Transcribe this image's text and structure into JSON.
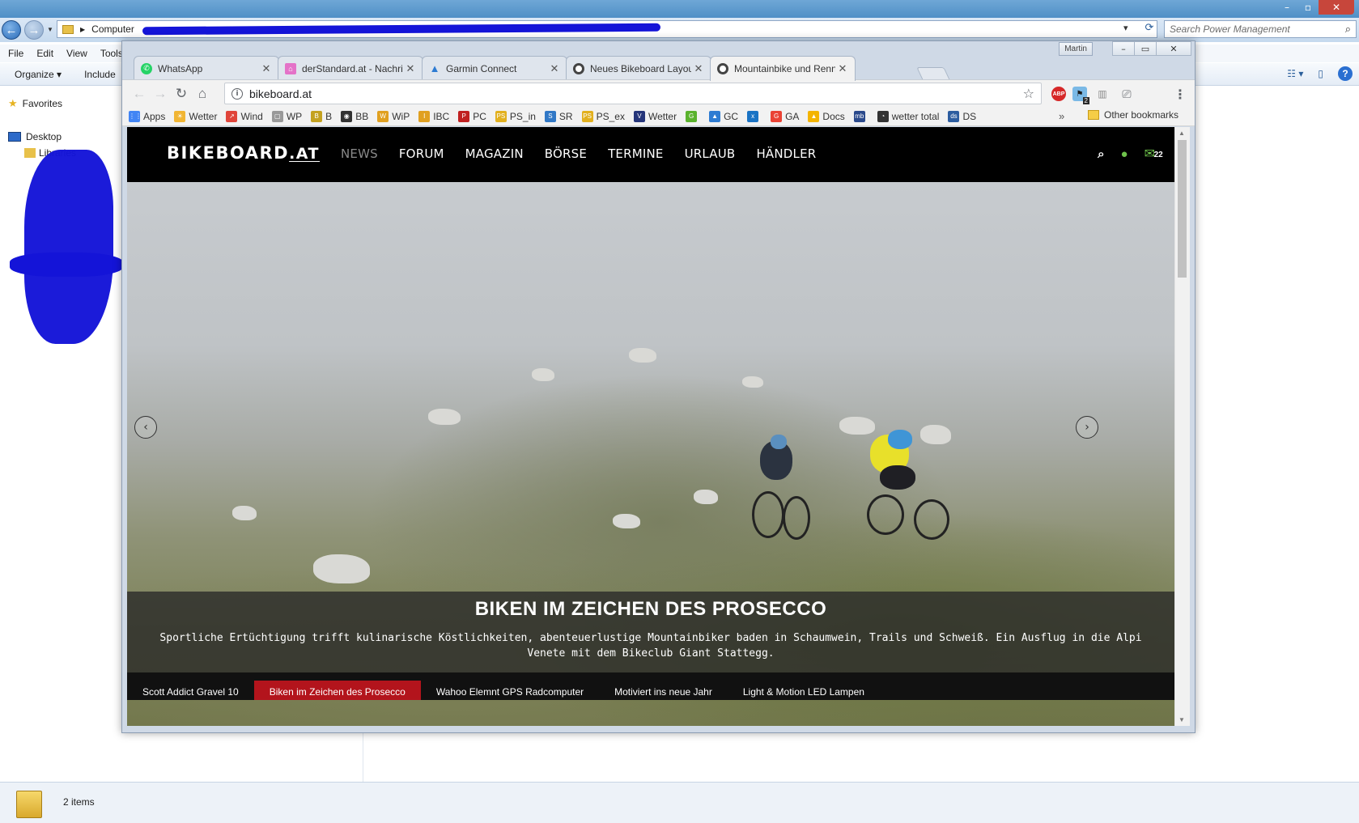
{
  "explorer": {
    "address_root": "Computer",
    "search_placeholder": "Search Power Management",
    "menu": [
      "File",
      "Edit",
      "View",
      "Tools"
    ],
    "toolbar": {
      "organize": "Organize ▾",
      "include": "Include"
    },
    "nav": {
      "favorites": "Favorites",
      "desktop": "Desktop",
      "libraries": "Libraries"
    },
    "status": {
      "items": "2 items"
    },
    "window_controls": {
      "minimize": "–",
      "maximize": "▫",
      "close": "✕"
    }
  },
  "chrome": {
    "profile": "Martin",
    "tabs": [
      {
        "title": "WhatsApp",
        "favicon": "whatsapp-icon",
        "color": "#25d366"
      },
      {
        "title": "derStandard.at - Nachrichten",
        "favicon": "derstandard-icon",
        "color": "#e472c8"
      },
      {
        "title": "Garmin Connect",
        "favicon": "garmin-icon",
        "color": "#2d7bd2"
      },
      {
        "title": "Neues Bikeboard Layout",
        "favicon": "bikeboard-icon",
        "color": "#444444"
      },
      {
        "title": "Mountainbike und Rennrad",
        "favicon": "bikeboard-icon",
        "color": "#444444"
      }
    ],
    "active_tab": 4,
    "url": "bikeboard.at",
    "bookmarks": [
      {
        "label": "Apps",
        "color": "#4285f4"
      },
      {
        "label": "Wetter",
        "color": "#f1b533"
      },
      {
        "label": "Wind",
        "color": "#e0453a"
      },
      {
        "label": "WP",
        "color": "#999999"
      },
      {
        "label": "B",
        "color": "#c4a220"
      },
      {
        "label": "BB",
        "color": "#333333"
      },
      {
        "label": "WiP",
        "color": "#e0a020"
      },
      {
        "label": "IBC",
        "color": "#e0a020"
      },
      {
        "label": "PC",
        "color": "#c02020"
      },
      {
        "label": "PS_in",
        "color": "#e2b01e"
      },
      {
        "label": "SR",
        "color": "#3178c6"
      },
      {
        "label": "PS_ex",
        "color": "#e2b01e"
      },
      {
        "label": "Wetter",
        "color": "#25357a"
      },
      {
        "label": "",
        "color": "#5ab22d"
      },
      {
        "label": "GC",
        "color": "#2d7bd2"
      },
      {
        "label": "",
        "color": "#1a73c4"
      },
      {
        "label": "GA",
        "color": "#ea4335"
      },
      {
        "label": "Docs",
        "color": "#f4b400"
      },
      {
        "label": "",
        "color": "#2b4a8c"
      },
      {
        "label": "wetter total",
        "color": "#333333"
      },
      {
        "label": "DS",
        "color": "#2c5da0"
      }
    ],
    "bookmarks_more": "»",
    "other_bookmarks": "Other bookmarks",
    "extensions": {
      "abp": "ABP",
      "badge": "2"
    }
  },
  "site": {
    "logo_main": "BIKEBOARD",
    "logo_suffix": ".AT",
    "nav": [
      "NEWS",
      "FORUM",
      "MAGAZIN",
      "BÖRSE",
      "TERMINE",
      "URLAUB",
      "HÄNDLER"
    ],
    "active_nav": 0,
    "mail_count": "22",
    "hero": {
      "title": "BIKEN IM ZEICHEN DES PROSECCO",
      "text": "Sportliche Ertüchtigung trifft kulinarische Köstlichkeiten, abenteuerlustige Mountainbiker baden in Schaumwein, Trails und Schweiß. Ein Ausflug in die Alpi Venete mit dem Bikeclub Giant Stattegg."
    },
    "slides": [
      "Scott Addict Gravel 10",
      "Biken im Zeichen des Prosecco",
      "Wahoo Elemnt GPS Radcomputer",
      "Motiviert ins neue Jahr",
      "Light & Motion LED Lampen"
    ],
    "active_slide": 1,
    "accent": "#b3141c",
    "user_color": "#6ec24b"
  }
}
